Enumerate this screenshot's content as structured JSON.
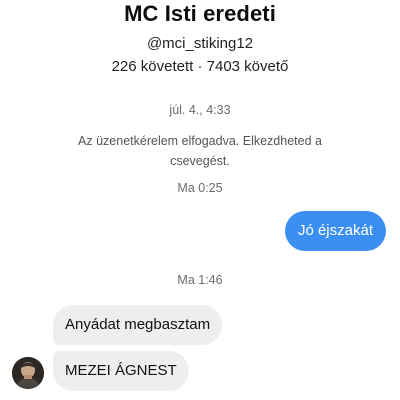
{
  "header": {
    "name": "MC Isti eredeti",
    "handle": "@mci_stiking12",
    "stats": "226 követett · 7403 követő"
  },
  "conversation": {
    "timestamp_1": "júl. 4., 4:33",
    "system_message": "Az üzenetkérelem elfogadva. Elkezdheted a csevegést.",
    "timestamp_2": "Ma 0:25",
    "outgoing_message": "Jó éjszakát",
    "timestamp_3": "Ma 1:46",
    "incoming_messages": [
      "Anyádat megbasztam",
      "MEZEI ÁGNEST"
    ]
  },
  "colors": {
    "outgoing_bubble": "#3b8ff3",
    "incoming_bubble": "#eeeeee",
    "timestamp_text": "#6b6b6b"
  },
  "icons": {
    "avatar": "profile-photo"
  }
}
